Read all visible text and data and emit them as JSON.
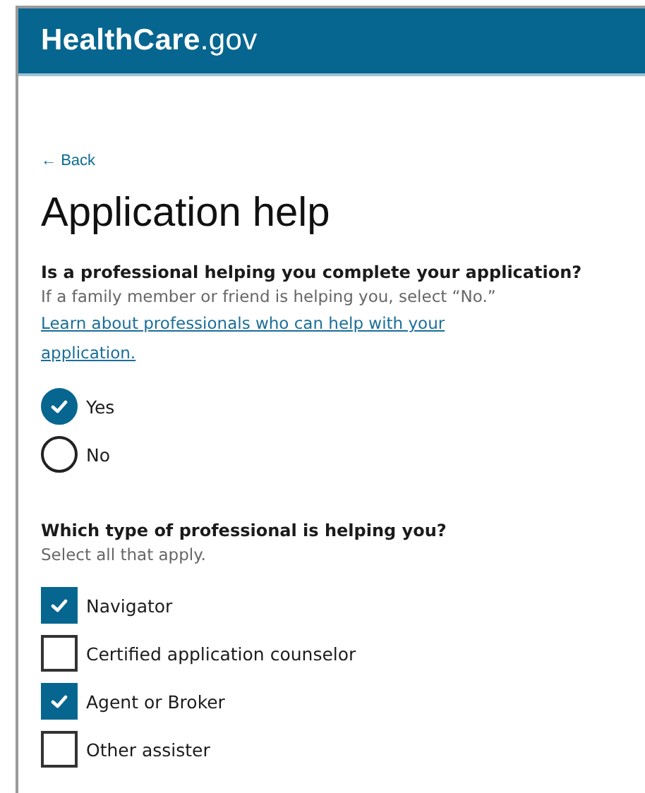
{
  "header": {
    "logo": "**HealthCare**.gov"
  },
  "back_link": {
    "icon": "←",
    "label": "Back"
  },
  "title": "Application help",
  "question_1": {
    "label": "Is a professional helping you complete your application?",
    "hint": "If a family member or friend is helping you, select “No.”",
    "link": "Learn about professionals who can help with your application.",
    "options": [
      {
        "label": "Yes",
        "selected": true
      },
      {
        "label": "No",
        "selected": false
      }
    ]
  },
  "question_2": {
    "label": "Which type of professional is helping you?",
    "hint": "Select all that apply.",
    "options": [
      {
        "label": "Navigator",
        "checked": true
      },
      {
        "label": "Certified application counselor",
        "checked": false
      },
      {
        "label": "Agent or Broker",
        "checked": true
      },
      {
        "label": "Other assister",
        "checked": false
      }
    ]
  }
}
